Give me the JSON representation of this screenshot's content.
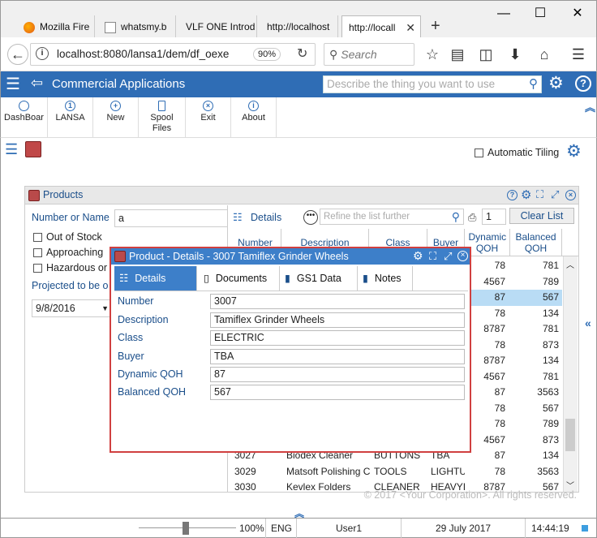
{
  "browser": {
    "tabs": [
      {
        "label": "Mozilla Fire",
        "icon": "firefox-icon"
      },
      {
        "label": "whatsmy.b",
        "icon": "page-icon"
      },
      {
        "label": "VLF ONE Introd",
        "icon": "blank-icon"
      },
      {
        "label": "http://localhost",
        "icon": "blank-icon"
      },
      {
        "label": "http://locall",
        "icon": "blank-icon",
        "active": true
      }
    ],
    "url": "localhost:8080/lansa1/dem/df_oexe",
    "zoom": "90%",
    "search_placeholder": "Search"
  },
  "app": {
    "title": "Commercial Applications",
    "search_placeholder": "Describe the thing you want to use",
    "accent": "#2f6db5"
  },
  "toolbar": {
    "items": [
      {
        "label": "DashBoar",
        "icon": "dashboard-icon"
      },
      {
        "label": "LANSA",
        "icon": "lansa-icon"
      },
      {
        "label": "New",
        "icon": "plus-icon"
      },
      {
        "label": "Spool Files",
        "icon": "spool-icon"
      },
      {
        "label": "Exit",
        "icon": "close-icon"
      },
      {
        "label": "About",
        "icon": "info-icon"
      }
    ]
  },
  "subbar": {
    "auto_tiling_label": "Automatic Tiling"
  },
  "products": {
    "title": "Products",
    "filter": {
      "number_or_name_label": "Number or Name",
      "number_or_name_value": "a",
      "out_of_stock": "Out of Stock",
      "approaching": "Approaching",
      "hazardous": "Hazardous or",
      "projected_label": "Projected to be o",
      "date_value": "9/8/2016"
    },
    "list_toolbar": {
      "details_label": "Details",
      "refine_placeholder": "Refine the list further",
      "count_value": "1",
      "clear_label": "Clear List"
    },
    "columns": [
      "Number",
      "Description",
      "Class",
      "Buyer",
      "Dynamic QOH",
      "Balanced QOH"
    ],
    "rows": [
      {
        "dq": "78",
        "bq": "781"
      },
      {
        "dq": "4567",
        "bq": "789"
      },
      {
        "dq": "87",
        "bq": "567",
        "selected": true
      },
      {
        "dq": "78",
        "bq": "134"
      },
      {
        "dq": "8787",
        "bq": "781"
      },
      {
        "dq": "78",
        "bq": "873"
      },
      {
        "dq": "8787",
        "bq": "134"
      },
      {
        "dq": "4567",
        "bq": "781"
      },
      {
        "dq": "87",
        "bq": "3563"
      },
      {
        "dq": "78",
        "bq": "567"
      },
      {
        "dq": "78",
        "bq": "789"
      },
      {
        "dq": "4567",
        "bq": "873"
      },
      {
        "num": "3027",
        "desc": "Biodex Cleaner",
        "cls": "BUTTONS",
        "buyer": "TBA",
        "dq": "87",
        "bq": "134"
      },
      {
        "num": "3029",
        "desc": "Matsoft Polishing C",
        "cls": "TOOLS",
        "buyer": "LIGHTU",
        "dq": "78",
        "bq": "3563"
      },
      {
        "num": "3030",
        "desc": "Kevlex Folders",
        "cls": "CLEANER",
        "buyer": "HEAVYI",
        "dq": "8787",
        "bq": "567"
      }
    ],
    "footer": "© 2017 <Your Corporation>. All rights reserved."
  },
  "modal": {
    "title": "Product - Details - 3007 Tamiflex Grinder Wheels",
    "tabs": [
      "Details",
      "Documents",
      "GS1 Data",
      "Notes"
    ],
    "fields": [
      {
        "label": "Number",
        "value": "3007"
      },
      {
        "label": "Description",
        "value": "Tamiflex Grinder Wheels"
      },
      {
        "label": "Class",
        "value": "ELECTRIC"
      },
      {
        "label": "Buyer",
        "value": "TBA"
      },
      {
        "label": "Dynamic QOH",
        "value": "87"
      },
      {
        "label": "Balanced QOH",
        "value": "567"
      }
    ]
  },
  "status": {
    "zoom": "100%",
    "lang": "ENG",
    "user": "User1",
    "date": "29 July 2017",
    "time": "14:44:19"
  }
}
